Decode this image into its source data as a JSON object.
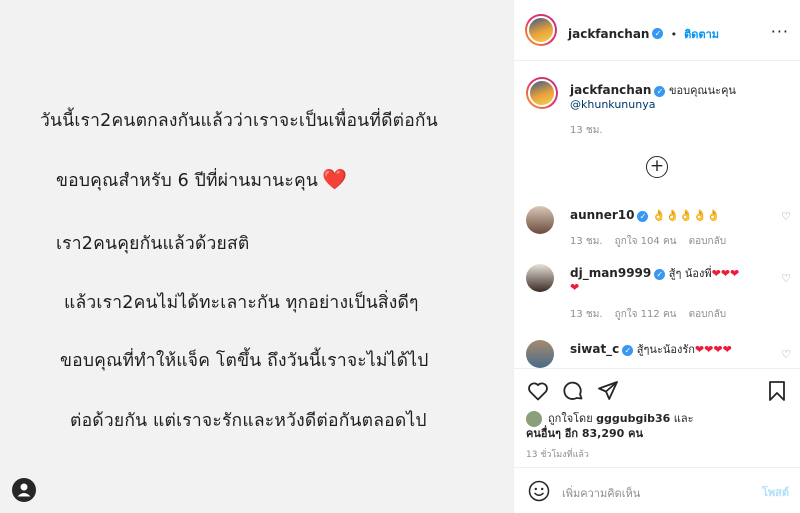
{
  "post": {
    "lines": [
      "วันนี้เรา2คนตกลงกันแล้วว่าเราจะเป็นเพื่อนที่ดีต่อกัน",
      "ขอบคุณสำหรับ 6 ปีที่ผ่านมานะคุน",
      "เรา2คนคุยกันแล้วด้วยสติ",
      "แล้วเรา2คนไม่ได้ทะเลาะกัน ทุกอย่างเป็นสิ่งดีๆ",
      "ขอบคุณที่ทำให้แจ็ค โตขึ้น  ถึงวันนี้เราจะไม่ได้ไป",
      "ต่อด้วยกัน แต่เราจะรักและหวังดีต่อกันตลอดไป"
    ],
    "heart": "❤️"
  },
  "header": {
    "username": "jackfanchan",
    "separator": "•",
    "follow_label": "ติดตาม",
    "more": "···"
  },
  "caption": {
    "username": "jackfanchan",
    "text": "ขอบคุณนะคุน",
    "mention": "@khunkununya",
    "time": "13 ชม."
  },
  "comments": [
    {
      "username": "aunner10",
      "text": "👌👌👌👌👌",
      "time": "13 ชม.",
      "likes": "ถูกใจ 104 คน",
      "reply": "ตอบกลับ"
    },
    {
      "username": "dj_man9999",
      "text": "สู้ๆ น้องพี่",
      "hearts": "❤❤❤",
      "hearts2": "❤",
      "time": "13 ชม.",
      "likes": "ถูกใจ 112 คน",
      "reply": "ตอบกลับ"
    },
    {
      "username": "siwat_c",
      "text": "สู้ๆนะน้องรัก",
      "hearts": "❤❤❤❤"
    }
  ],
  "likes": {
    "prefix": "ถูกใจโดย",
    "user": "gggubgib36",
    "and": "และ",
    "others": "คนอื่นๆ อีก 83,290 คน"
  },
  "timestamp": "13 ชั่วโมงที่แล้ว",
  "comment_input": {
    "placeholder": "เพิ่มความคิดเห็น",
    "post_label": "โพสต์"
  },
  "colors": {
    "accent": "#0095f6",
    "verified": "#3897f0",
    "heart": "#ed1c3a"
  }
}
